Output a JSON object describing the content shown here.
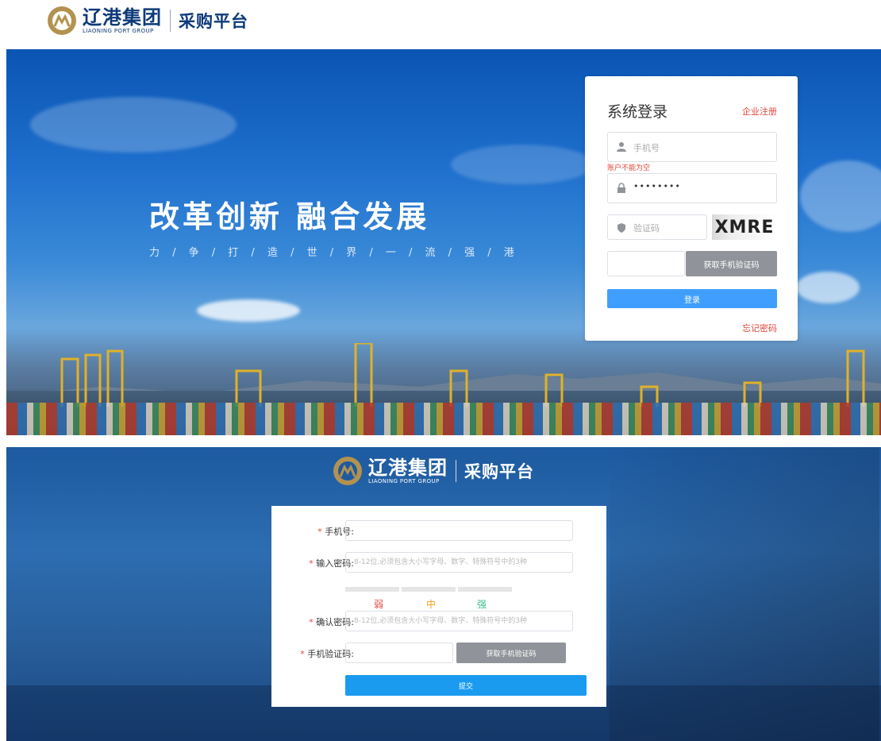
{
  "brand": {
    "name_cn": "辽港集团",
    "name_en": "LIAONING PORT GROUP",
    "platform": "采购平台",
    "color": "#0d3a79",
    "gold": "#b3924f"
  },
  "hero": {
    "slogan": "改革创新 融合发展",
    "subslogan": "力 / 争 / 打 / 造 / 世 / 界 / 一 / 流 / 强 / 港"
  },
  "login": {
    "title": "系统登录",
    "register_link": "企业注册",
    "phone_placeholder": "手机号",
    "error_text": "账户不能为空",
    "password_value": "••••••••",
    "captcha_placeholder": "验证码",
    "captcha_image_text": "XMRE",
    "sms_button": "获取手机验证码",
    "login_button": "登录",
    "forgot_link": "忘记密码",
    "primary_color": "#409eff",
    "error_color": "#e0463a"
  },
  "register": {
    "phone_label": "手机号:",
    "password_label": "输入密码:",
    "password_placeholder": "8-12位,必须包含大小写字母、数字、特殊符号中的3种",
    "strength": {
      "weak": "弱",
      "medium": "中",
      "strong": "强",
      "weak_color": "#e0463a",
      "medium_color": "#f0a020",
      "strong_color": "#3cc08a"
    },
    "confirm_label": "确认密码:",
    "confirm_placeholder": "8-12位,必须包含大小写字母、数字、特殊符号中的3种",
    "sms_label": "手机验证码:",
    "sms_button": "获取手机验证码",
    "submit_button": "提交",
    "required_mark": "*"
  }
}
